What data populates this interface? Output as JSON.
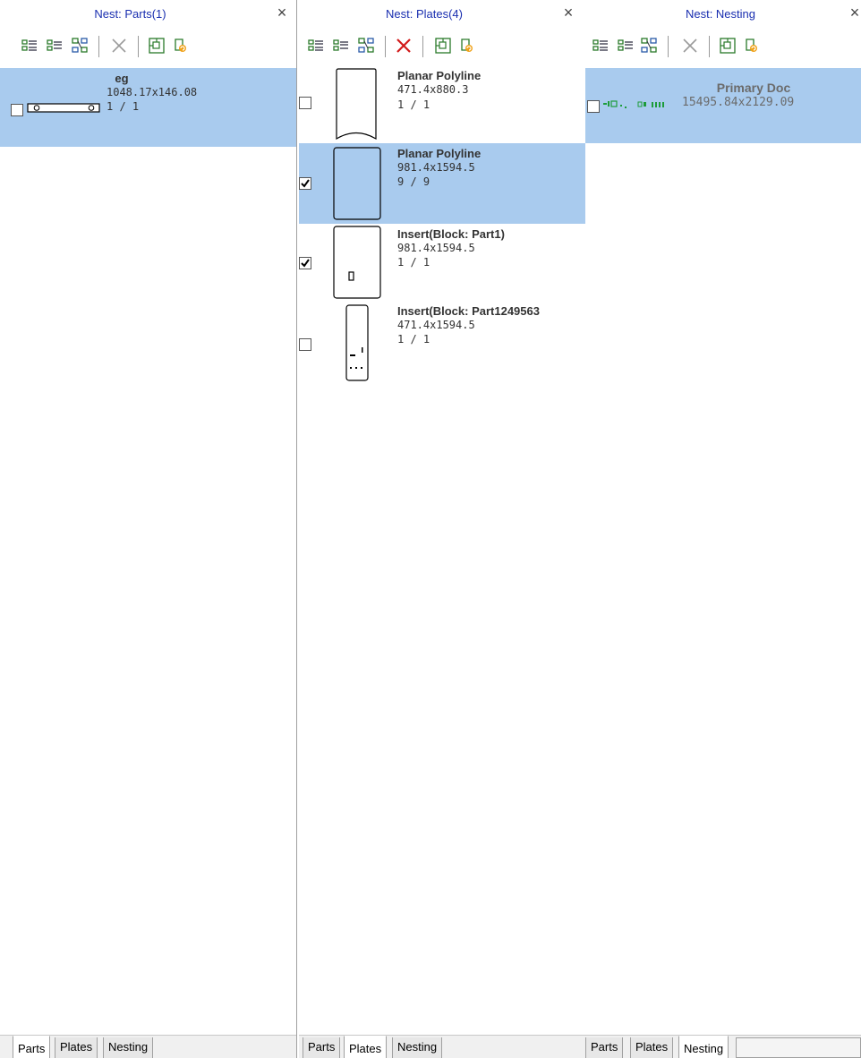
{
  "panels": {
    "parts": {
      "title": "Nest: Parts(1)",
      "close": "×",
      "tabs": [
        "Parts",
        "Plates",
        "Nesting"
      ],
      "active_tab": "Parts",
      "rows": [
        {
          "title": "eg",
          "dims": "1048.17x146.08",
          "count": "1 / 1",
          "checked": false,
          "selected": true
        }
      ]
    },
    "plates": {
      "title": "Nest: Plates(4)",
      "close": "×",
      "tabs": [
        "Parts",
        "Plates",
        "Nesting"
      ],
      "active_tab": "Plates",
      "rows": [
        {
          "title": "Planar Polyline",
          "dims": "471.4x880.3",
          "count": "1 / 1",
          "checked": false,
          "selected": false
        },
        {
          "title": "Planar Polyline",
          "dims": "981.4x1594.5",
          "count": "9 / 9",
          "checked": true,
          "selected": true
        },
        {
          "title": "Insert(Block: Part1)",
          "dims": "981.4x1594.5",
          "count": "1 / 1",
          "checked": true,
          "selected": false
        },
        {
          "title": "Insert(Block: Part1249563",
          "dims": "471.4x1594.5",
          "count": "1 / 1",
          "checked": false,
          "selected": false
        }
      ]
    },
    "nesting": {
      "title": "Nest: Nesting",
      "close": "×",
      "tabs": [
        "Parts",
        "Plates",
        "Nesting"
      ],
      "active_tab": "Nesting",
      "rows": [
        {
          "title": "Primary Doc",
          "dims": "15495.84x2129.09",
          "checked": false,
          "selected": true
        }
      ]
    }
  },
  "toolbar_icons": [
    "list-detail-icon",
    "list-compact-icon",
    "tree-view-icon",
    "delete-icon",
    "add-item-icon",
    "refresh-icon"
  ],
  "colors": {
    "title_blue": "#1a2fb0",
    "selection": "#a9cbee",
    "delete_active": "#d21a1a",
    "delete_inactive": "#9a9a9a",
    "preview_green": "#1d9c3a"
  }
}
